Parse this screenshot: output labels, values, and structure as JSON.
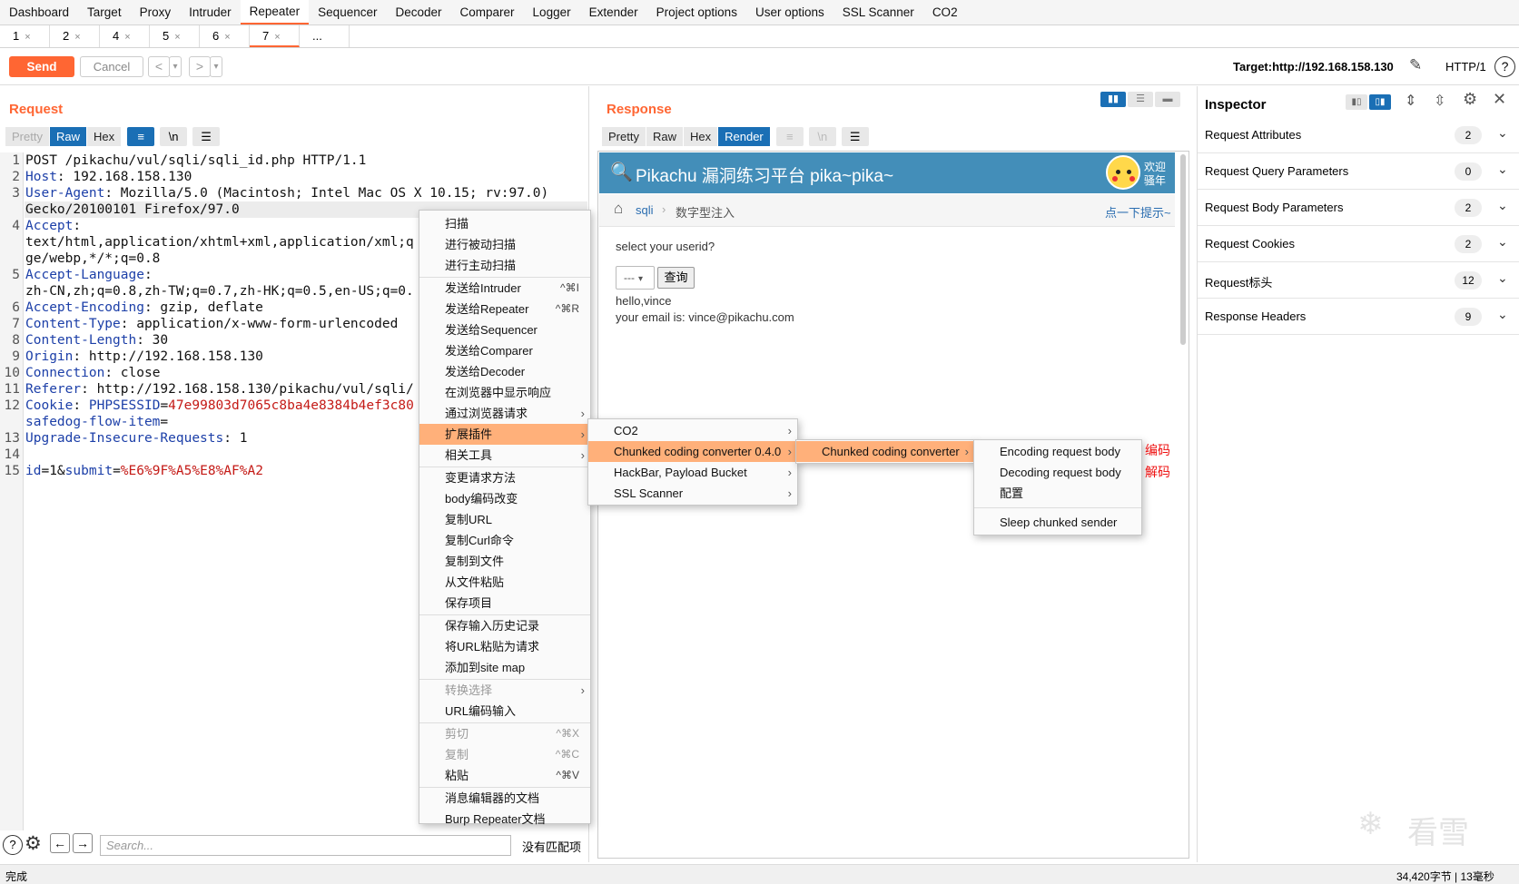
{
  "nav": {
    "tabs": [
      "Dashboard",
      "Target",
      "Proxy",
      "Intruder",
      "Repeater",
      "Sequencer",
      "Decoder",
      "Comparer",
      "Logger",
      "Extender",
      "Project options",
      "User options",
      "SSL Scanner",
      "CO2"
    ],
    "active_tab": "Repeater"
  },
  "repeater_tabs": [
    "1",
    "2",
    "4",
    "5",
    "6",
    "7",
    "..."
  ],
  "repeater_active": "7",
  "toolbar": {
    "send": "Send",
    "cancel": "Cancel",
    "back": "<",
    "back_drop": "▾",
    "fwd": ">",
    "fwd_drop": "▾",
    "target": "Target:http://192.168.158.130",
    "http_version": "HTTP/1",
    "help": "?"
  },
  "request": {
    "title": "Request",
    "views": [
      "Pretty",
      "Raw",
      "Hex"
    ],
    "active_view": "Raw",
    "wrap_icon": "≡",
    "newline_label": "\\n",
    "menu_icon": "☰",
    "lines": [
      {
        "num": "1",
        "parts": [
          {
            "t": "POST /pikachu/vul/sqli/sqli_id.php HTTP/1.1",
            "c": ""
          }
        ]
      },
      {
        "num": "2",
        "parts": [
          {
            "t": "Host",
            "c": "k"
          },
          {
            "t": ": 192.168.158.130",
            "c": ""
          }
        ]
      },
      {
        "num": "3",
        "parts": [
          {
            "t": "User-Agent",
            "c": "k"
          },
          {
            "t": ": Mozilla/5.0 (Macintosh; Intel Mac OS X 10.15; rv:97.0)",
            "c": ""
          }
        ]
      },
      {
        "num": "",
        "parts": [
          {
            "t": "Gecko/20100101 Firefox/97.0",
            "c": ""
          }
        ]
      },
      {
        "num": "4",
        "parts": [
          {
            "t": "Accept",
            "c": "k"
          },
          {
            "t": ":",
            "c": ""
          }
        ]
      },
      {
        "num": "",
        "parts": [
          {
            "t": "text/html,application/xhtml+xml,application/xml;q",
            "c": ""
          }
        ]
      },
      {
        "num": "",
        "parts": [
          {
            "t": "ge/webp,*/*;q=0.8",
            "c": ""
          }
        ]
      },
      {
        "num": "5",
        "parts": [
          {
            "t": "Accept-Language",
            "c": "k"
          },
          {
            "t": ":",
            "c": ""
          }
        ]
      },
      {
        "num": "",
        "parts": [
          {
            "t": "zh-CN,zh;q=0.8,zh-TW;q=0.7,zh-HK;q=0.5,en-US;q=0.",
            "c": ""
          }
        ]
      },
      {
        "num": "6",
        "parts": [
          {
            "t": "Accept-Encoding",
            "c": "k"
          },
          {
            "t": ": gzip, deflate",
            "c": ""
          }
        ]
      },
      {
        "num": "7",
        "parts": [
          {
            "t": "Content-Type",
            "c": "k"
          },
          {
            "t": ": application/x-www-form-urlencoded",
            "c": ""
          }
        ]
      },
      {
        "num": "8",
        "parts": [
          {
            "t": "Content-Length",
            "c": "k"
          },
          {
            "t": ": 30",
            "c": ""
          }
        ]
      },
      {
        "num": "9",
        "parts": [
          {
            "t": "Origin",
            "c": "k"
          },
          {
            "t": ": http://192.168.158.130",
            "c": ""
          }
        ]
      },
      {
        "num": "10",
        "parts": [
          {
            "t": "Connection",
            "c": "k"
          },
          {
            "t": ": close",
            "c": ""
          }
        ]
      },
      {
        "num": "11",
        "parts": [
          {
            "t": "Referer",
            "c": "k"
          },
          {
            "t": ": http://192.168.158.130/pikachu/vul/sqli/",
            "c": ""
          }
        ]
      },
      {
        "num": "12",
        "parts": [
          {
            "t": "Cookie",
            "c": "k"
          },
          {
            "t": ": ",
            "c": ""
          },
          {
            "t": "PHPSESSID",
            "c": "k"
          },
          {
            "t": "=",
            "c": ""
          },
          {
            "t": "47e99803d7065c8ba4e8384b4ef3c80",
            "c": "r"
          }
        ]
      },
      {
        "num": "",
        "parts": [
          {
            "t": "safedog-flow-item",
            "c": "k"
          },
          {
            "t": "=",
            "c": ""
          }
        ]
      },
      {
        "num": "13",
        "parts": [
          {
            "t": "Upgrade-Insecure-Requests",
            "c": "k"
          },
          {
            "t": ": 1",
            "c": ""
          }
        ]
      },
      {
        "num": "14",
        "parts": [
          {
            "t": "",
            "c": ""
          }
        ]
      },
      {
        "num": "15",
        "parts": [
          {
            "t": "id",
            "c": "k"
          },
          {
            "t": "=1&",
            "c": ""
          },
          {
            "t": "submit",
            "c": "k"
          },
          {
            "t": "=",
            "c": ""
          },
          {
            "t": "%E6%9F%A5%E8%AF%A2",
            "c": "r"
          }
        ]
      }
    ],
    "search_placeholder": "Search...",
    "no_match": "没有匹配项"
  },
  "response": {
    "title": "Response",
    "views": [
      "Pretty",
      "Raw",
      "Hex",
      "Render"
    ],
    "active_view": "Render",
    "page": {
      "header": "Pikachu 漏洞练习平台 pika~pika~",
      "welcome_1": "欢迎",
      "welcome_2": "骚年",
      "crumb_1": "sqli",
      "crumb_2": "数字型注入",
      "hint": "点一下提示~",
      "prompt": "select your userid?",
      "select_value": "---",
      "query_button": "查询",
      "result_1": "hello,vince",
      "result_2": "your email is: vince@pikachu.com"
    }
  },
  "inspector": {
    "title": "Inspector",
    "rows": [
      {
        "label": "Request Attributes",
        "count": "2"
      },
      {
        "label": "Request Query Parameters",
        "count": "0"
      },
      {
        "label": "Request Body Parameters",
        "count": "2"
      },
      {
        "label": "Request Cookies",
        "count": "2"
      },
      {
        "label": "Request标头",
        "count": "12"
      },
      {
        "label": "Response Headers",
        "count": "9"
      }
    ]
  },
  "context_menu": {
    "items": [
      {
        "label": "扫描",
        "shortcut": "",
        "sub": false,
        "dis": false,
        "sel": false
      },
      {
        "label": "进行被动扫描",
        "shortcut": "",
        "sub": false,
        "dis": false,
        "sel": false
      },
      {
        "label": "进行主动扫描",
        "shortcut": "",
        "sub": false,
        "dis": false,
        "sel": false,
        "sep": true
      },
      {
        "label": "发送给Intruder",
        "shortcut": "^⌘I",
        "sub": false,
        "dis": false,
        "sel": false
      },
      {
        "label": "发送给Repeater",
        "shortcut": "^⌘R",
        "sub": false,
        "dis": false,
        "sel": false
      },
      {
        "label": "发送给Sequencer",
        "shortcut": "",
        "sub": false,
        "dis": false,
        "sel": false
      },
      {
        "label": "发送给Comparer",
        "shortcut": "",
        "sub": false,
        "dis": false,
        "sel": false
      },
      {
        "label": "发送给Decoder",
        "shortcut": "",
        "sub": false,
        "dis": false,
        "sel": false
      },
      {
        "label": "在浏览器中显示响应",
        "shortcut": "",
        "sub": false,
        "dis": false,
        "sel": false
      },
      {
        "label": "通过浏览器请求",
        "shortcut": "",
        "sub": true,
        "dis": false,
        "sel": false
      },
      {
        "label": "扩展插件",
        "shortcut": "",
        "sub": true,
        "dis": false,
        "sel": true
      },
      {
        "label": "相关工具",
        "shortcut": "",
        "sub": true,
        "dis": false,
        "sel": false,
        "sep": true
      },
      {
        "label": "变更请求方法",
        "shortcut": "",
        "sub": false,
        "dis": false,
        "sel": false
      },
      {
        "label": "body编码改变",
        "shortcut": "",
        "sub": false,
        "dis": false,
        "sel": false
      },
      {
        "label": "复制URL",
        "shortcut": "",
        "sub": false,
        "dis": false,
        "sel": false
      },
      {
        "label": "复制Curl命令",
        "shortcut": "",
        "sub": false,
        "dis": false,
        "sel": false
      },
      {
        "label": "复制到文件",
        "shortcut": "",
        "sub": false,
        "dis": false,
        "sel": false
      },
      {
        "label": "从文件粘贴",
        "shortcut": "",
        "sub": false,
        "dis": false,
        "sel": false
      },
      {
        "label": "保存项目",
        "shortcut": "",
        "sub": false,
        "dis": false,
        "sel": false,
        "sep": true
      },
      {
        "label": "保存输入历史记录",
        "shortcut": "",
        "sub": false,
        "dis": false,
        "sel": false
      },
      {
        "label": "将URL粘贴为请求",
        "shortcut": "",
        "sub": false,
        "dis": false,
        "sel": false
      },
      {
        "label": "添加到site map",
        "shortcut": "",
        "sub": false,
        "dis": false,
        "sel": false,
        "sep": true
      },
      {
        "label": "转换选择",
        "shortcut": "",
        "sub": true,
        "dis": true,
        "sel": false
      },
      {
        "label": "URL编码输入",
        "shortcut": "",
        "sub": false,
        "dis": false,
        "sel": false,
        "sep": true
      },
      {
        "label": "剪切",
        "shortcut": "^⌘X",
        "sub": false,
        "dis": true,
        "sel": false
      },
      {
        "label": "复制",
        "shortcut": "^⌘C",
        "sub": false,
        "dis": true,
        "sel": false
      },
      {
        "label": "粘贴",
        "shortcut": "^⌘V",
        "sub": false,
        "dis": false,
        "sel": false,
        "sep": true
      },
      {
        "label": "消息编辑器的文档",
        "shortcut": "",
        "sub": false,
        "dis": false,
        "sel": false
      },
      {
        "label": "Burp Repeater文档",
        "shortcut": "",
        "sub": false,
        "dis": false,
        "sel": false
      }
    ],
    "extensions": [
      {
        "label": "CO2",
        "sel": false
      },
      {
        "label": "Chunked coding converter 0.4.0",
        "sel": true
      },
      {
        "label": "HackBar, Payload Bucket",
        "sel": false
      },
      {
        "label": "SSL Scanner",
        "sel": false
      }
    ],
    "chunked": [
      {
        "label": "Chunked coding converter",
        "sel": true
      }
    ],
    "chunked_actions": [
      "Encoding request body",
      "Decoding request body",
      "配置",
      "Sleep chunked sender"
    ]
  },
  "annotations": {
    "encode": "编码",
    "decode": "解码"
  },
  "status": {
    "left": "完成",
    "right": "34,420字节 | 13毫秒"
  },
  "watermark": "看雪"
}
